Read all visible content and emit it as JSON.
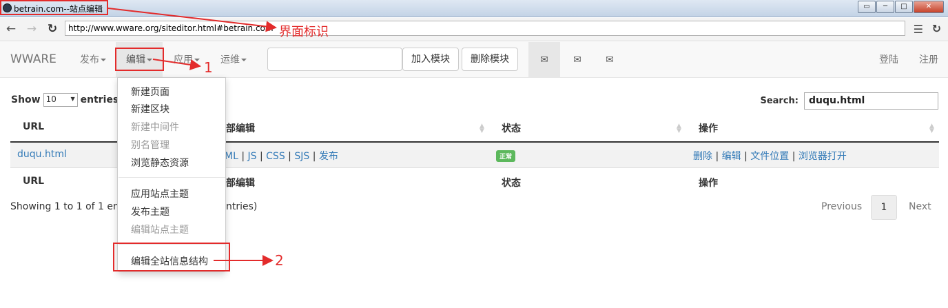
{
  "window": {
    "title": "betrain.com--站点编辑",
    "buttons": [
      "▭",
      "─",
      "□",
      "✕"
    ]
  },
  "address_bar": {
    "url": "http://www.wware.org/siteditor.html#betrain.com"
  },
  "navbar": {
    "brand": "WWARE",
    "menus": [
      "发布",
      "编辑",
      "应用",
      "运维"
    ],
    "search_value": "",
    "add_module": "加入模块",
    "delete_module": "删除模块",
    "env_icons": [
      "✉",
      "✉",
      "✉"
    ],
    "login": "登陆",
    "register": "注册"
  },
  "dropdown": {
    "group1": [
      {
        "label": "新建页面",
        "disabled": false
      },
      {
        "label": "新建区块",
        "disabled": false
      },
      {
        "label": "新建中间件",
        "disabled": true
      },
      {
        "label": "别名管理",
        "disabled": true
      },
      {
        "label": "浏览静态资源",
        "disabled": false
      }
    ],
    "group2": [
      {
        "label": "应用站点主题",
        "disabled": false
      },
      {
        "label": "发布主题",
        "disabled": false
      },
      {
        "label": "编辑站点主题",
        "disabled": true
      }
    ],
    "group3": [
      {
        "label": "编辑全站信息结构",
        "disabled": false
      }
    ]
  },
  "table": {
    "show_label": "Show",
    "length_value": "10",
    "entries_label": "entries",
    "search_label": "Search:",
    "search_value": "duqu.html",
    "headers": [
      "URL",
      "部编辑",
      "状态",
      "操作"
    ],
    "row": {
      "url": "duqu.html",
      "edit_links": [
        "ML",
        "JS",
        "CSS",
        "SJS",
        "发布"
      ],
      "status": "正常",
      "actions": [
        "删除",
        "编辑",
        "文件位置",
        "浏览器打开"
      ]
    },
    "footer_headers": [
      "URL",
      "部编辑",
      "状态",
      "操作"
    ],
    "info_left": "Showing 1 to 1 of 1 entri",
    "info_right": "ntries)",
    "pagination": {
      "previous": "Previous",
      "page": "1",
      "next": "Next"
    }
  },
  "annotations": {
    "title_label": "界面标识",
    "marker_1": "1",
    "marker_2": "2",
    "color": "#e32b2b"
  }
}
